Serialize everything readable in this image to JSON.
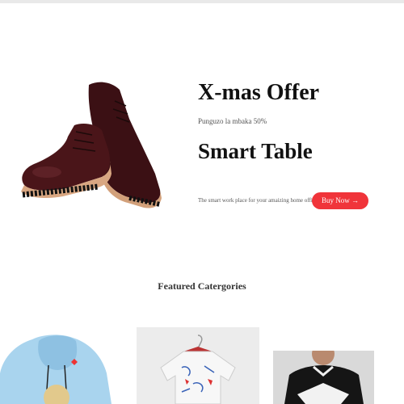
{
  "hero": {
    "offer_title": "X-mas Offer",
    "offer_subtitle": "Punguzo la mbaka 50%",
    "product_title": "Smart Table",
    "tagline": "The smart work place for your amaizing home office",
    "buy_button_label": "Buy Now →",
    "accent_color": "#f0343a"
  },
  "featured": {
    "heading": "Featured Catergories",
    "categories": [
      {
        "icon": "hoodie-image"
      },
      {
        "icon": "printed-shirt-image"
      },
      {
        "icon": "black-tshirt-image"
      }
    ]
  }
}
